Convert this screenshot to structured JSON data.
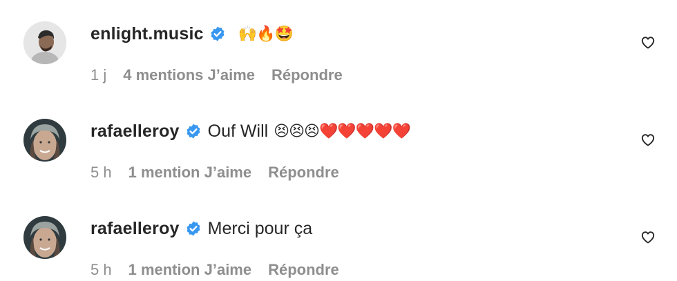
{
  "comments": [
    {
      "username": "enlight.music",
      "text": "",
      "emoji": "🙌🔥🤩",
      "time": "1 j",
      "likes": "4 mentions J’aime",
      "reply": "Répondre"
    },
    {
      "username": "rafaelleroy",
      "text": "Ouf Will",
      "emoji": "😣😣😣❤️❤️❤️❤️❤️",
      "time": "5 h",
      "likes": "1 mention J’aime",
      "reply": "Répondre"
    },
    {
      "username": "rafaelleroy",
      "text": "Merci pour ça",
      "emoji": "",
      "time": "5 h",
      "likes": "1 mention J’aime",
      "reply": "Répondre"
    }
  ],
  "colors": {
    "verified": "#3897f0",
    "meta_text": "#8e8e8e",
    "primary_text": "#262626"
  },
  "icons": {
    "verified": "verified-badge-icon",
    "like": "heart-outline-icon"
  }
}
